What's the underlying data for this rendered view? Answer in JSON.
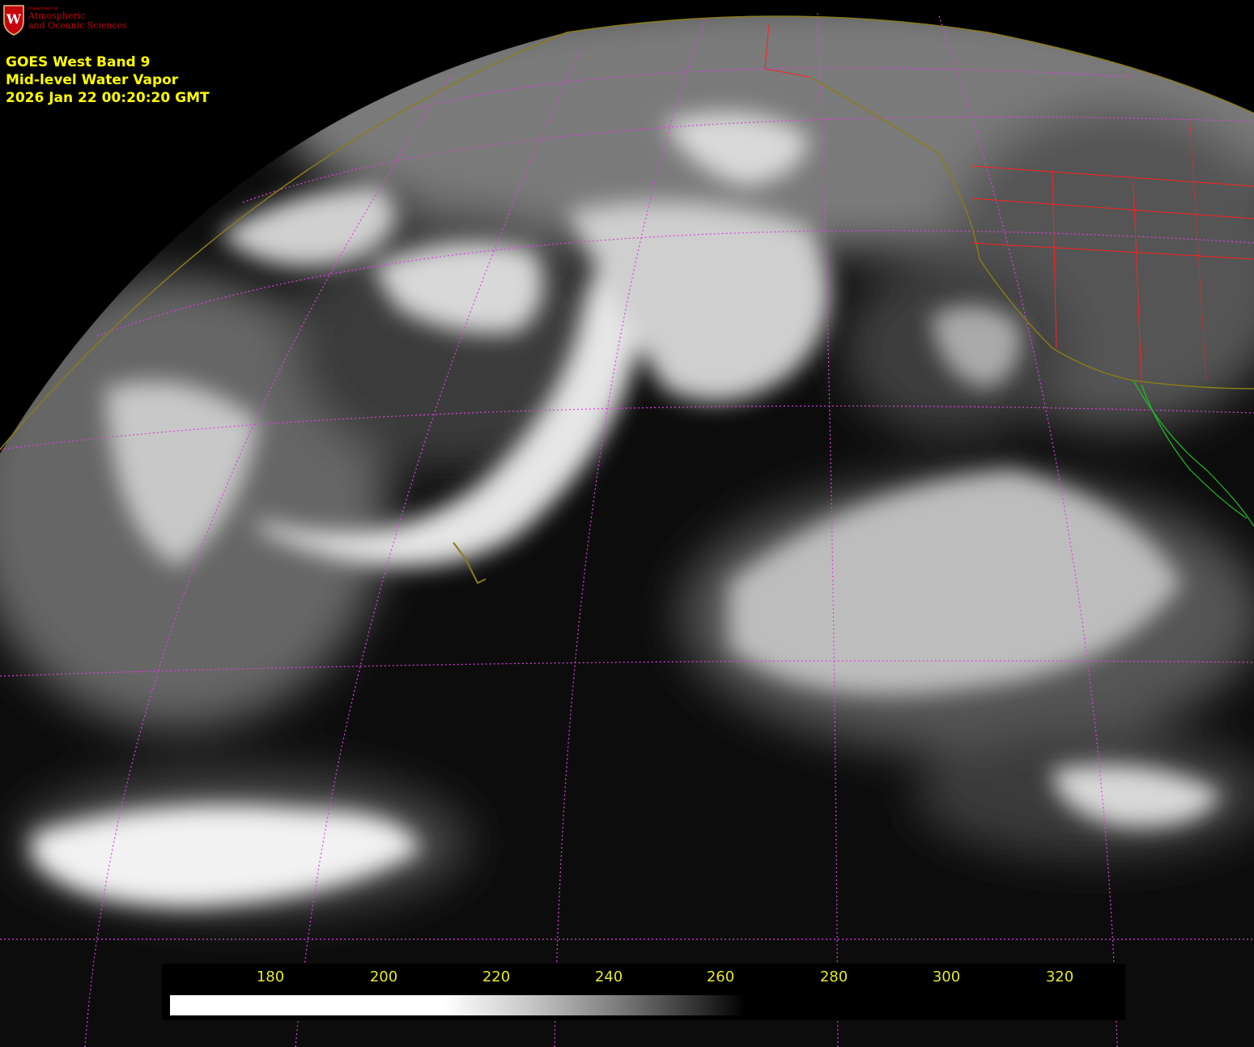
{
  "logo": {
    "department_text": "Department of",
    "name_line1": "Atmospheric",
    "name_line2": "and Oceanic Sciences",
    "shield_letter": "W",
    "icon": "uw-shield-icon",
    "color": "#c5050c"
  },
  "title": {
    "line1": "GOES West Band 9",
    "line2": "Mid-level Water Vapor",
    "line3": "2026 Jan 22  00:20:20 GMT",
    "color": "#ffff00"
  },
  "colorbar": {
    "labels": [
      "180",
      "200",
      "220",
      "240",
      "260",
      "280",
      "300",
      "320"
    ],
    "label_color": "#e6e633",
    "gradient_colors": [
      "#ffffff",
      "#808080",
      "#000000"
    ]
  },
  "map_colors": {
    "graticule": "#e040e0",
    "coastline": "#8a7a1a",
    "borders": "#ff2020",
    "mexico_coast": "#20c020"
  }
}
